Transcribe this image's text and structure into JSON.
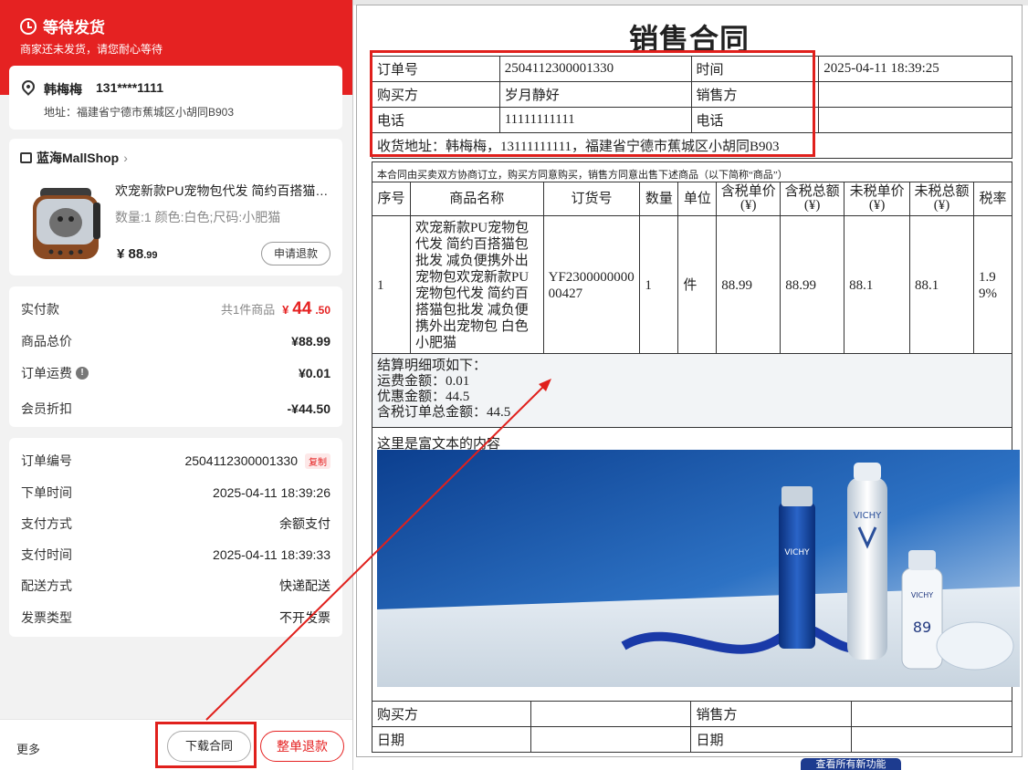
{
  "order_status": {
    "title": "等待发货",
    "subtitle": "商家还未发货，请您耐心等待"
  },
  "address": {
    "name": "韩梅梅",
    "phone": "131****1111",
    "detail": "地址：福建省宁德市蕉城区小胡同B903"
  },
  "shop": {
    "name": "蓝海MallShop",
    "product_name": "欢宠新款PU宠物包代发 简约百搭猫包批发 减负便携外出宠物包",
    "product_spec": "数量:1   颜色:白色;尺码:小肥猫",
    "price_symbol": "¥",
    "price_int": "88",
    "price_dec": ".99",
    "refund_label": "申请退款"
  },
  "summary": {
    "paid_label": "实付款",
    "paid_count": "共1件商品",
    "paid_symbol": "¥",
    "paid_int": "44",
    "paid_dec": ".50",
    "total_label": "商品总价",
    "total_value": "¥88.99",
    "freight_label": "订单运费",
    "freight_value": "¥0.01",
    "discount_label": "会员折扣",
    "discount_value": "-¥44.50"
  },
  "order_info": {
    "no_label": "订单编号",
    "no_value": "2504112300001330",
    "copy_label": "复制",
    "time_label": "下单时间",
    "time_value": "2025-04-11 18:39:26",
    "pay_method_label": "支付方式",
    "pay_method_value": "余额支付",
    "pay_time_label": "支付时间",
    "pay_time_value": "2025-04-11 18:39:33",
    "delivery_label": "配送方式",
    "delivery_value": "快递配送",
    "invoice_label": "发票类型",
    "invoice_value": "不开发票"
  },
  "bottom_bar": {
    "more": "更多",
    "download": "下载合同",
    "refund_all": "整单退款"
  },
  "contract": {
    "title": "销售合同",
    "order_no_label": "订单号",
    "order_no": "2504112300001330",
    "time_label": "时间",
    "time": "2025-04-11 18:39:25",
    "buyer_label": "购买方",
    "buyer": "岁月静好",
    "seller_label": "销售方",
    "seller": "",
    "phone_label": "电话",
    "phone": "11111111111",
    "seller_phone_label": "电话",
    "seller_phone": "",
    "address": "收货地址：韩梅梅，13111111111，福建省宁德市蕉城区小胡同B903",
    "note": "本合同由买卖双方协商订立，购买方同意购买，销售方同意出售下述商品（以下简称“商品”）",
    "columns": [
      "序号",
      "商品名称",
      "订货号",
      "数量",
      "单位",
      "含税单价(¥)",
      "含税总额(¥)",
      "未税单价(¥)",
      "未税总额(¥)",
      "税率"
    ],
    "items": [
      {
        "index": "1",
        "name": "欢宠新款PU宠物包代发 简约百搭猫包批发 减负便携外出宠物包欢宠新款PU宠物包代发 简约百搭猫包批发 减负便携外出宠物包 白色 小肥猫",
        "sku": "YF230000000000427",
        "qty": "1",
        "unit": "件",
        "price_tax": "88.99",
        "total_tax": "88.99",
        "price_notax": "88.1",
        "total_notax": "88.1",
        "tax_rate": "1.99%"
      }
    ],
    "settlement_title": "结算明细项如下：",
    "settlement_freight": "运费金额：0.01",
    "settlement_discount": "优惠金额：44.5",
    "settlement_total": "含税订单总金额：44.5",
    "rich_text": "这里是富文本的内容",
    "footer_buyer_label": "购买方",
    "footer_seller_label": "销售方",
    "footer_date_label": "日期",
    "footer_date_label2": "日期"
  },
  "banner": "查看所有新功能",
  "colors": {
    "brand_red": "#e52222",
    "highlight_red": "#e0201c",
    "panel_bg": "#f2f2f2"
  }
}
